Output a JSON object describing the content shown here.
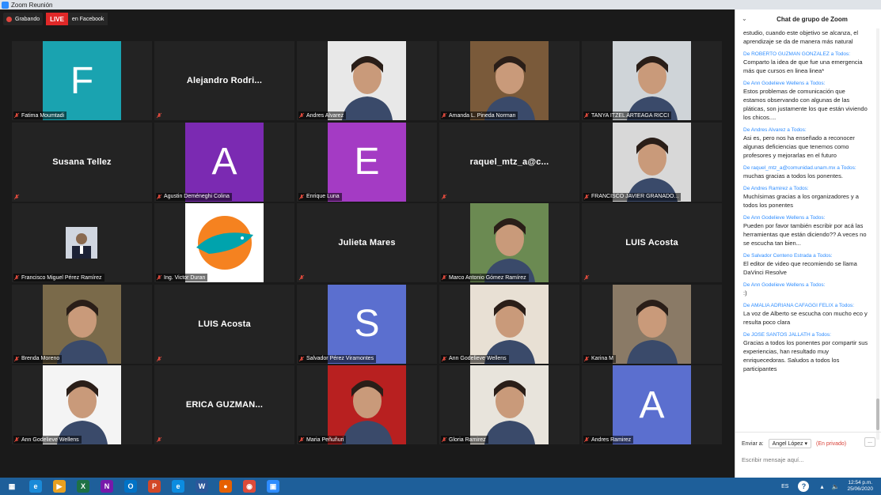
{
  "window": {
    "title": "Zoom Reunión"
  },
  "recording": {
    "label": "Grabando",
    "live_badge": "LIVE",
    "live_target": "en Facebook"
  },
  "colors": {
    "zoom_blue": "#2d8cff",
    "live_red": "#e02828",
    "taskbar": "#1e5f9a"
  },
  "tiles": [
    {
      "label": "Fatima Moumtadi",
      "avatar_letter": "F",
      "avatar_color": "#1aa3b0"
    },
    {
      "label": "",
      "display_name": "Alejandro  Rodri..."
    },
    {
      "label": "Andres Alvarez"
    },
    {
      "label": "Amanda L. Pineda Norman"
    },
    {
      "label": "TANYA ITZEL ARTEAGA RICCI"
    },
    {
      "label": "",
      "display_name": "Susana Tellez"
    },
    {
      "label": "Agustin Deméneghi Colina",
      "avatar_letter": "A",
      "avatar_color": "#7b2ab2"
    },
    {
      "label": "Enrique Luna",
      "avatar_letter": "E",
      "avatar_color": "#a43bc4"
    },
    {
      "label": "",
      "display_name": "raquel_mtz_a@c..."
    },
    {
      "label": "FRANCISCO JAVIER GRANADO..."
    },
    {
      "label": "Francisco Miguel Pérez Ramírez"
    },
    {
      "label": "Ing. Victor Duran"
    },
    {
      "label": "",
      "display_name": "Julieta Mares"
    },
    {
      "label": "Marco Antonio Gómez Ramírez"
    },
    {
      "label": "",
      "display_name": "LUIS Acosta"
    },
    {
      "label": "Brenda Moreno"
    },
    {
      "label": "",
      "display_name": "LUIS Acosta"
    },
    {
      "label": "Salvador Pérez Viramontes",
      "avatar_letter": "S",
      "avatar_color": "#5b6fcf"
    },
    {
      "label": "Ann Godelieve Wellens"
    },
    {
      "label": "Karina M"
    },
    {
      "label": "Ann Godelieve Wellens"
    },
    {
      "label": "",
      "display_name": "ERICA  GUZMAN..."
    },
    {
      "label": "Maria Peñuñuri"
    },
    {
      "label": "Gloria Ramirez"
    },
    {
      "label": "Andres Ramirez",
      "avatar_letter": "A",
      "avatar_color": "#5b6fcf"
    }
  ],
  "chat": {
    "title": "Chat de grupo de Zoom",
    "messages": [
      {
        "from": "",
        "body": "estudio, cuando este objetivo se alcanza, el aprendizaje se da de manera más natural"
      },
      {
        "from": "De ROBERTO GUZMAN GONZALEZ a Todos:",
        "body": "Comparto la idea de que fue una emergencia más que cursos en linea linea*"
      },
      {
        "from": "De Ann Godelieve Wellens a Todos:",
        "body": "Estos problemas de comunicación que estamos observando con algunas de las pláticas, son justamente los que están viviendo los chicos...."
      },
      {
        "from": "De Andres Alvarez a Todos:",
        "body": "Asi es, pero nos ha enseñado a reconocer algunas deficiencias que tenemos como profesores y mejorarlas en el futuro"
      },
      {
        "from": "De raquel_mtz_a@comunidad.unam.mx a Todos:",
        "body": "muchas gracias a todos los ponentes."
      },
      {
        "from": "De Andres Ramirez a Todos:",
        "body": "Muchísimas gracias a los organizadores y a todos los ponentes"
      },
      {
        "from": "De Ann Godelieve Wellens a Todos:",
        "body": "Pueden por favor también escribir por acá las herramientas que están diciendo?? A veces no se escucha tan bien..."
      },
      {
        "from": "De Salvador Centeno Estrada a Todos:",
        "body": "El editor de video que recomiendo se llama DaVinci Resolve"
      },
      {
        "from": "De Ann Godelieve Wellens a Todos:",
        "body": ":)"
      },
      {
        "from": "De AMALIA ADRIANA CAFAGGI FELIX a Todos:",
        "body": "La voz de Alberto se escucha con mucho eco y resulta poco clara"
      },
      {
        "from": "De JOSE SANTOS JALLATH a Todos:",
        "body": "Gracias a todos los ponentes por compartir sus experiencias, han resultado muy enriquecedoras. Saludos a todos los participantes"
      }
    ],
    "send_to_label": "Enviar a:",
    "recipient": "Angel López",
    "private_note": "(En privado)",
    "more": "...",
    "input_placeholder": "Escribir mensaje aquí..."
  },
  "taskbar": {
    "icons": [
      "start-icon",
      "ie-icon",
      "media-player-icon",
      "excel-icon",
      "onenote-icon",
      "outlook-icon",
      "powerpoint-icon",
      "edge-icon",
      "word-icon",
      "firefox-icon",
      "chrome-icon",
      "zoom-icon"
    ],
    "language": "ES",
    "help": "?",
    "time": "12:54 p.m.",
    "date": "25/06/2020"
  }
}
